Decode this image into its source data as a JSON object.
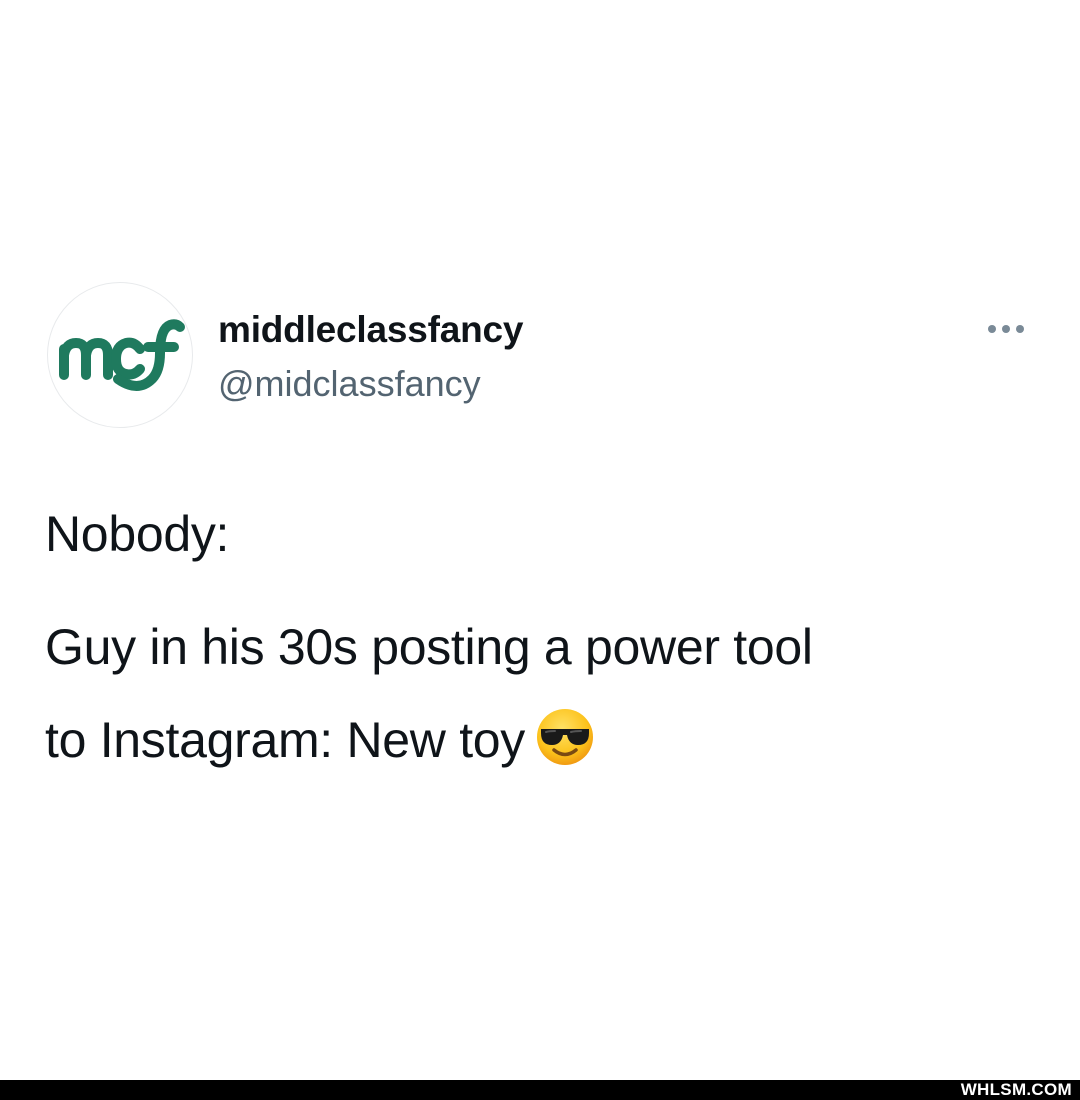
{
  "tweet": {
    "avatar": {
      "logo_text": "mcf",
      "brand_color": "#1f7a5e"
    },
    "display_name": "middleclassfancy",
    "handle": "@midclassfancy",
    "more_icon": "more-horizontal-icon",
    "text_lines": [
      "Nobody:",
      "Guy in his 30s posting a power tool",
      "to Instagram: New toy"
    ],
    "emoji": "smiling-face-with-sunglasses"
  },
  "footer": {
    "watermark": "WHLSM.COM"
  },
  "colors": {
    "background": "#ffffff",
    "text_primary": "#0f1419",
    "text_secondary": "#536471",
    "footer_bar": "#000000"
  }
}
